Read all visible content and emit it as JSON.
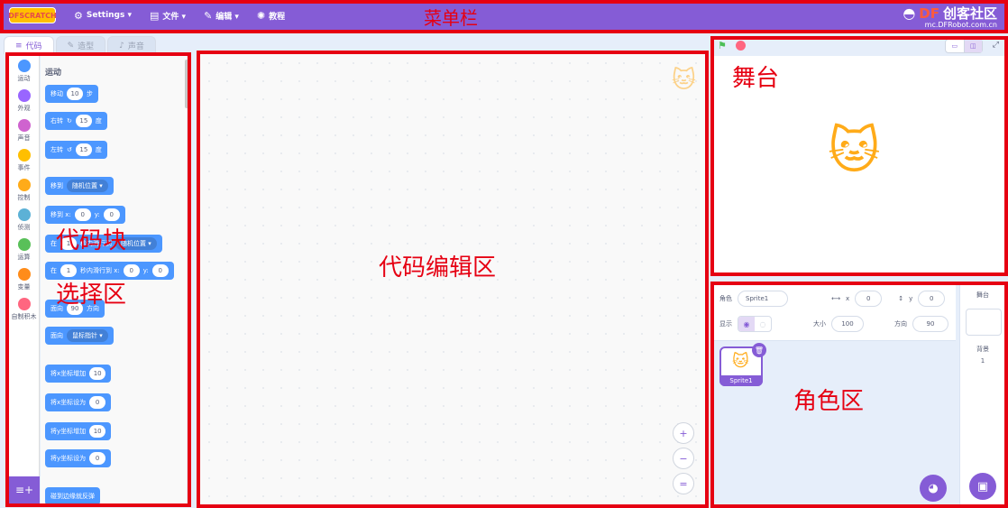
{
  "menubar": {
    "logo_text": "DFSCRATCH",
    "items": [
      {
        "icon": "gear-icon",
        "icon_glyph": "⚙",
        "label": "Settings ▾"
      },
      {
        "icon": "file-icon",
        "icon_glyph": "▤",
        "label": "文件 ▾"
      },
      {
        "icon": "pencil-icon",
        "icon_glyph": "✎",
        "label": "编辑 ▾"
      },
      {
        "icon": "bulb-icon",
        "icon_glyph": "✺",
        "label": "教程"
      }
    ],
    "annotation": "菜单栏",
    "brand": {
      "prefix": "DF",
      "name": "创客社区",
      "url": "mc.DFRobot.com.cn"
    }
  },
  "tabs": [
    {
      "icon_glyph": "≡",
      "label": "代码"
    },
    {
      "icon_glyph": "✎",
      "label": "造型"
    },
    {
      "icon_glyph": "♪",
      "label": "声音"
    }
  ],
  "categories": [
    {
      "label": "运动",
      "color": "#4c97ff"
    },
    {
      "label": "外观",
      "color": "#9966ff"
    },
    {
      "label": "声音",
      "color": "#cf63cf"
    },
    {
      "label": "事件",
      "color": "#ffbf00"
    },
    {
      "label": "控制",
      "color": "#ffab19"
    },
    {
      "label": "侦测",
      "color": "#5cb1d6"
    },
    {
      "label": "运算",
      "color": "#59c059"
    },
    {
      "label": "变量",
      "color": "#ff8c1a"
    },
    {
      "label": "自制积木",
      "color": "#ff6680"
    }
  ],
  "palette": {
    "title": "运动",
    "blocks": {
      "move": {
        "a": "移动",
        "v": "10",
        "b": "步"
      },
      "turn_right": {
        "a": "右转",
        "icon": "↻",
        "v": "15",
        "b": "度"
      },
      "turn_left": {
        "a": "左转",
        "icon": "↺",
        "v": "15",
        "b": "度"
      },
      "goto": {
        "a": "移到",
        "drop": "随机位置 ▾"
      },
      "goto_xy": {
        "a": "移到 x:",
        "x": "0",
        "ylbl": "y:",
        "y": "0"
      },
      "glide_to": {
        "a": "在",
        "v": "1",
        "b": "秒内滑行到",
        "drop": "随机位置 ▾"
      },
      "glide_xy": {
        "a": "在",
        "v": "1",
        "b": "秒内滑行到 x:",
        "x": "0",
        "ylbl": "y:",
        "y": "0"
      },
      "point_dir": {
        "a": "面向",
        "v": "90",
        "b": "方向"
      },
      "point_towards": {
        "a": "面向",
        "drop": "鼠标指针 ▾"
      },
      "change_x": {
        "a": "将x坐标增加",
        "v": "10"
      },
      "set_x": {
        "a": "将x坐标设为",
        "v": "0"
      },
      "change_y": {
        "a": "将y坐标增加",
        "v": "10"
      },
      "set_y": {
        "a": "将y坐标设为",
        "v": "0"
      },
      "bounce": {
        "a": "碰到边缘就反弹"
      }
    },
    "annotation_line1": "代码块",
    "annotation_line2": "选择区"
  },
  "code_area": {
    "annotation": "代码编辑区",
    "zoom_in": "+",
    "zoom_out": "−",
    "reset": "="
  },
  "stage": {
    "annotation": "舞台",
    "flag": "⚑"
  },
  "sprite_info": {
    "sprite_label": "角色",
    "sprite_name": "Sprite1",
    "x_label": "x",
    "x_value": "0",
    "y_label": "y",
    "y_value": "0",
    "show_label": "显示",
    "size_label": "大小",
    "size_value": "100",
    "direction_label": "方向",
    "direction_value": "90"
  },
  "sprite_list": {
    "sprite_name": "Sprite1",
    "annotation": "角色区"
  },
  "stage_panel": {
    "title": "舞台",
    "backdrop_label": "背景",
    "backdrop_count": "1"
  }
}
